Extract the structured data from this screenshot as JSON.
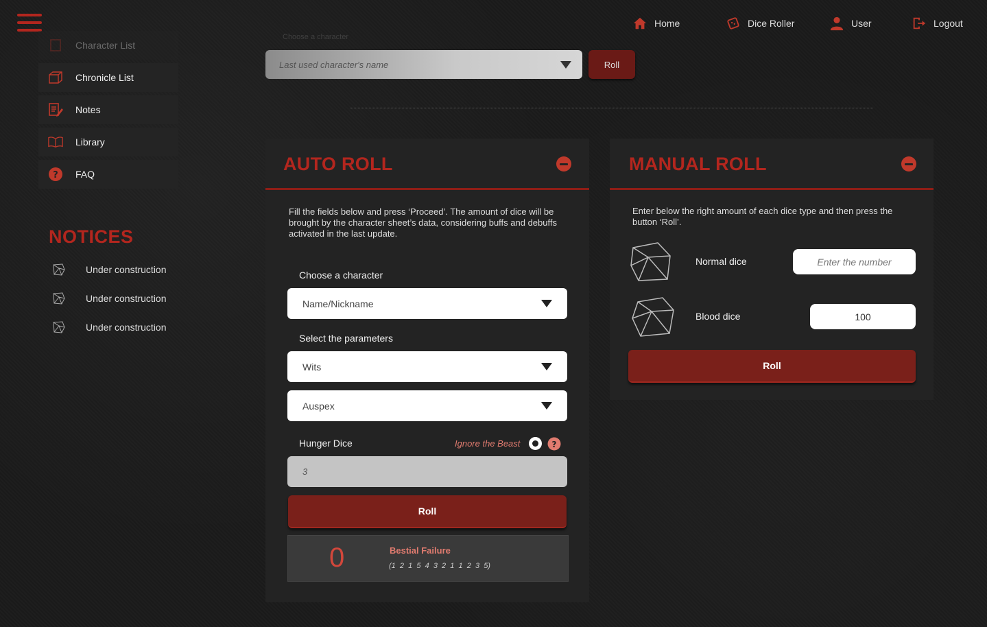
{
  "header": {
    "nav": [
      {
        "label": "Home",
        "icon": "home-icon"
      },
      {
        "label": "Dice Roller",
        "icon": "dice-icon"
      },
      {
        "label": "User",
        "icon": "user-icon"
      },
      {
        "label": "Logout",
        "icon": "logout-icon"
      }
    ]
  },
  "sidebar": {
    "items": [
      {
        "label": "Character List",
        "icon": "character-icon"
      },
      {
        "label": "Chronicle List",
        "icon": "chronicle-icon"
      },
      {
        "label": "Notes",
        "icon": "notes-icon"
      },
      {
        "label": "Library",
        "icon": "book-icon"
      },
      {
        "label": "FAQ",
        "icon": "question-icon"
      }
    ],
    "notices_title": "NOTICES",
    "notices": [
      "Under construction",
      "Under construction",
      "Under construction"
    ]
  },
  "top": {
    "faded_text": "Choose a character",
    "select_placeholder": "Last used character's name",
    "roll_label": "Roll"
  },
  "auto_roll": {
    "title": "AUTO ROLL",
    "description": "Fill the fields below and press ‘Proceed’. The amount of dice will be brought by the character sheet’s data, considering buffs and debuffs activated in the last update.",
    "choose_label": "Choose a character",
    "character_value": "Name/Nickname",
    "params_label": "Select the parameters",
    "param1": "Wits",
    "param2": "Auspex",
    "hunger_label": "Hunger Dice",
    "ignore_label": "Ignore the Beast",
    "hunger_value": "3",
    "roll_label": "Roll",
    "result": {
      "successes": "0",
      "outcome": "Bestial Failure",
      "dice": "(1  2  1  5  4  3  2  1  1  2  3  5)"
    }
  },
  "manual_roll": {
    "title": "MANUAL ROLL",
    "description": "Enter below the right amount of each dice type and then press the button ‘Roll’.",
    "normal_label": "Normal dice",
    "normal_placeholder": "Enter the number",
    "blood_label": "Blood dice",
    "blood_value": "100",
    "roll_label": "Roll"
  },
  "colors": {
    "accent": "#b3261e",
    "button": "#7a201a",
    "outcome_text": "#e07b6f"
  }
}
